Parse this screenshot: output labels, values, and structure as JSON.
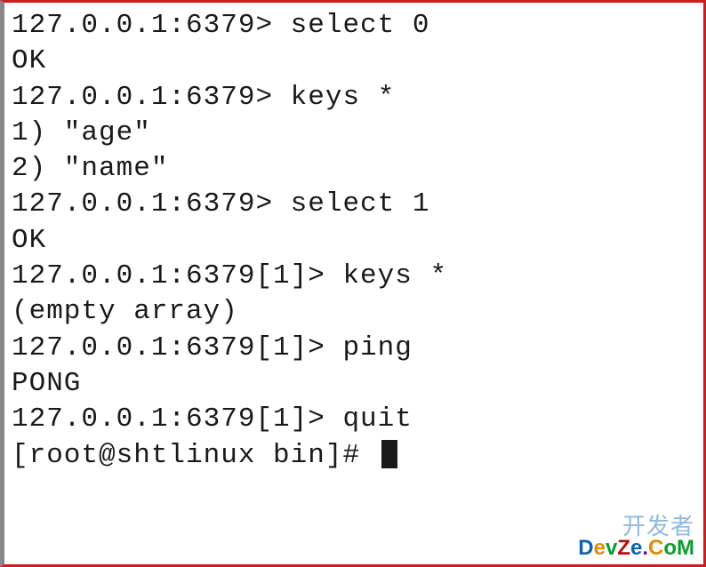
{
  "lines": {
    "l0": "127.0.0.1:6379> select 0",
    "l1": "OK",
    "l2": "127.0.0.1:6379> keys *",
    "l3": "1) \"age\"",
    "l4": "2) \"name\"",
    "l5": "127.0.0.1:6379> select 1",
    "l6": "OK",
    "l7": "127.0.0.1:6379[1]> keys *",
    "l8": "(empty array)",
    "l9": "127.0.0.1:6379[1]> ping",
    "l10": "PONG",
    "l11": "127.0.0.1:6379[1]> quit",
    "l12": "[root@shtlinux bin]# "
  },
  "watermark": {
    "line1": "开发者",
    "line2": {
      "c1": "D",
      "c2": "e",
      "c3": "v",
      "c4": "Z",
      "c5": "e",
      "c6": ".",
      "c7": "C",
      "c8": "oM"
    }
  }
}
